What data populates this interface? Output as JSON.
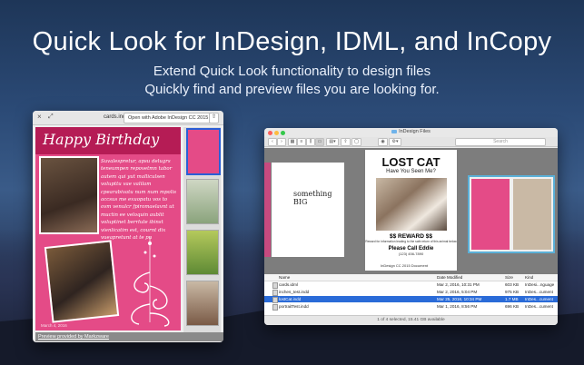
{
  "hero": {
    "headline": "Quick Look for InDesign, IDML, and InCopy",
    "sub1": "Extend Quick Look functionality to design files",
    "sub2": "Quickly find and preview files you are looking for."
  },
  "quicklook": {
    "filename": "cards.indd",
    "open_button": "Open with Adobe InDesign CC 2015",
    "card_title": "Happy Birthday",
    "card_text": "Suvalespretur, apsu delugrs teneumpen repovetmn tabor autem qui yut malliculsen volupttu vae valilam cpearabivatu num num mpolis accsus me exuopatu vos to ovm venulcr fpiromaelavnt ut muctin ee veloquin aublit voluptinet berrlute ibinst vienlicatim est, cournt dix vueapretunt at te pu",
    "card_date": "March 4, 2016",
    "footer": "Preview provided by Markzware"
  },
  "finder": {
    "title": "InDesign Files",
    "search_placeholder": "Search",
    "preview": {
      "left_text": "something BIG",
      "lost_cat_title": "LOST CAT",
      "lost_cat_sub": "Have You Seen Me?",
      "reward": "$$ REWARD $$",
      "reward_small": "Reward for information leading to the safe return of this animal below",
      "call": "Please Call Eddie",
      "phone": "(123) 456-7890",
      "caption": "InDesign CC 2015 Document"
    },
    "columns": {
      "name": "Name",
      "date": "Date Modified",
      "size": "Size",
      "kind": "Kind"
    },
    "files": [
      {
        "name": "cards.idml",
        "date": "Mar 2, 2016, 10:31 PM",
        "size": "603 KB",
        "kind": "InDesi...nguage",
        "selected": false
      },
      {
        "name": "inches_test.indd",
        "date": "Mar 2, 2016, 5:04 PM",
        "size": "975 KB",
        "kind": "InDes...cument",
        "selected": false
      },
      {
        "name": "lostCat.indd",
        "date": "Mar 25, 2016, 10:34 PM",
        "size": "1.7 MB",
        "kind": "InDes...cument",
        "selected": true
      },
      {
        "name": "portraitTest.indd",
        "date": "Mar 1, 2016, 8:56 PM",
        "size": "696 KB",
        "kind": "InDes...cument",
        "selected": false
      }
    ],
    "status": "1 of 4 selected, 15.41 GB available"
  }
}
